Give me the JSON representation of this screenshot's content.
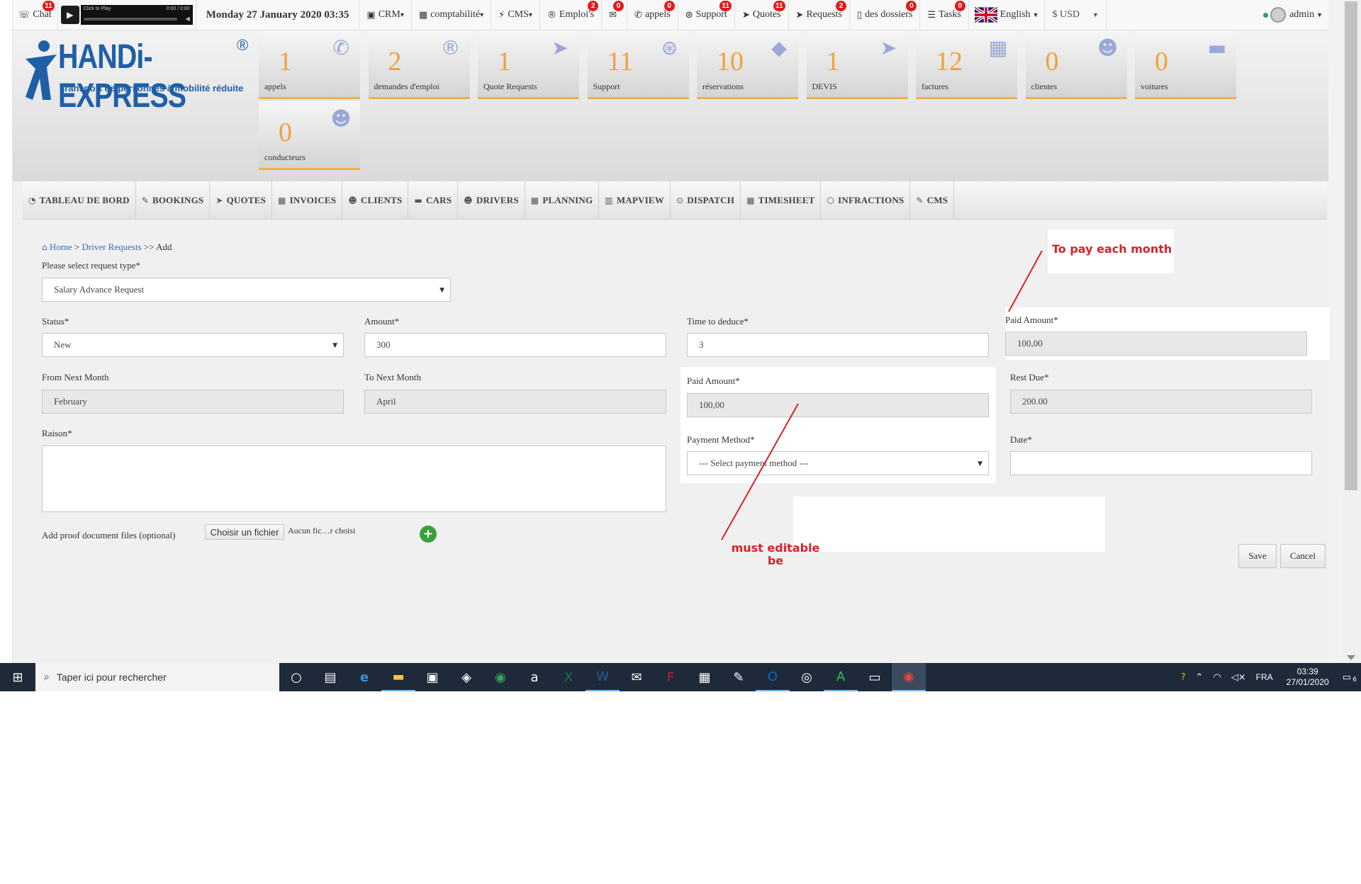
{
  "topnav": {
    "chat": {
      "label": "Chat",
      "badge": "11"
    },
    "player": {
      "title": "Click to Play",
      "time": "0:00 / 0:00"
    },
    "date": "Monday 27 January 2020 03:35",
    "items": [
      {
        "icon": "briefcase-icon",
        "glyph": "▣",
        "label": "CRM",
        "badge": ""
      },
      {
        "icon": "calculator-icon",
        "glyph": "▦",
        "label": "comptabilité",
        "badge": ""
      },
      {
        "icon": "bolt-icon",
        "glyph": "⚡",
        "label": "CMS",
        "badge": ""
      },
      {
        "icon": "registered-icon",
        "glyph": "®",
        "label": "Emploi's",
        "badge": "2"
      },
      {
        "icon": "envelope-icon",
        "glyph": "✉",
        "label": "",
        "badge": "0"
      },
      {
        "icon": "phone-icon",
        "glyph": "✆",
        "label": "appels",
        "badge": "0"
      },
      {
        "icon": "support-icon",
        "glyph": "⊛",
        "label": "Support",
        "badge": "11"
      },
      {
        "icon": "paper-plane-icon",
        "glyph": "➤",
        "label": "Quotes",
        "badge": "11"
      },
      {
        "icon": "paper-plane-icon",
        "glyph": "➤",
        "label": "Requests",
        "badge": "2"
      },
      {
        "icon": "file-icon",
        "glyph": "▯",
        "label": "des dossiers",
        "badge": "0"
      },
      {
        "icon": "tasks-icon",
        "glyph": "☰",
        "label": "Tasks",
        "badge": "0"
      }
    ],
    "language": "English",
    "currency": "$ USD",
    "user": "admin"
  },
  "logo": {
    "name": "HANDi-EXPRESS",
    "reg": "®",
    "tagline": "Transport de personnes à mobilité réduite"
  },
  "tiles": [
    {
      "value": "1",
      "label": "appels",
      "icon": "phone-icon",
      "glyph": "✆"
    },
    {
      "value": "2",
      "label": "demandes d'emploi",
      "icon": "registered-icon",
      "glyph": "®"
    },
    {
      "value": "1",
      "label": "Quote Requests",
      "icon": "paper-plane-icon",
      "glyph": "➤"
    },
    {
      "value": "11",
      "label": "Support",
      "icon": "support-icon",
      "glyph": "⊛"
    },
    {
      "value": "10",
      "label": "réservations",
      "icon": "ticket-icon",
      "glyph": "◆"
    },
    {
      "value": "1",
      "label": "DEVIS",
      "icon": "paper-plane-icon",
      "glyph": "➤"
    },
    {
      "value": "12",
      "label": "factures",
      "icon": "calculator-icon",
      "glyph": "▦"
    },
    {
      "value": "0",
      "label": "clientes",
      "icon": "users-icon",
      "glyph": "☻"
    },
    {
      "value": "0",
      "label": "voitures",
      "icon": "car-icon",
      "glyph": "▬"
    },
    {
      "value": "0",
      "label": "conducteurs",
      "icon": "user-icon",
      "glyph": "☻"
    }
  ],
  "menu": [
    {
      "label": "TABLEAU DE BORD",
      "glyph": "◔"
    },
    {
      "label": "BOOKINGS",
      "glyph": "✎"
    },
    {
      "label": "QUOTES",
      "glyph": "➤"
    },
    {
      "label": "INVOICES",
      "glyph": "▦"
    },
    {
      "label": "CLIENTS",
      "glyph": "☻"
    },
    {
      "label": "CARS",
      "glyph": "▬"
    },
    {
      "label": "DRIVERS",
      "glyph": "☻"
    },
    {
      "label": "PLANNING",
      "glyph": "▦"
    },
    {
      "label": "MAPVIEW",
      "glyph": "▥"
    },
    {
      "label": "DISPATCH",
      "glyph": "⊙"
    },
    {
      "label": "TIMESHEET",
      "glyph": "▦"
    },
    {
      "label": "INFRACTIONS",
      "glyph": "⬡"
    },
    {
      "label": "CMS",
      "glyph": "✎"
    }
  ],
  "breadcrumb": {
    "home": "Home",
    "sep1": ">",
    "section": "Driver Requests",
    "sep2": ">>",
    "current": "Add"
  },
  "form": {
    "request_type_label": "Please select request type*",
    "request_type_value": "Salary Advance Request",
    "status_label": "Status*",
    "status_value": "New",
    "amount_label": "Amount*",
    "amount_value": "300",
    "time_label": "Time to deduce*",
    "time_value": "3",
    "paid_label_top": "Paid Amount*",
    "paid_value_top": "100,00",
    "from_label": "From Next Month",
    "from_value": "February",
    "to_label": "To Next Month",
    "to_value": "April",
    "paid_label": "Paid Amount*",
    "paid_value": "100,00",
    "rest_label": "Rest Due*",
    "rest_value": "200.00",
    "raison_label": "Raison*",
    "payment_label": "Payment Method*",
    "payment_placeholder": "--- Select payment method ---",
    "date_label": "Date*",
    "proof_label": "Add proof document files (optional)",
    "file_button": "Choisir un fichier",
    "file_status": "Aucun fic…r choisi",
    "save": "Save",
    "cancel": "Cancel"
  },
  "annotations": {
    "top": "To pay each month",
    "bottom_line1": "must editable",
    "bottom_line2": "be",
    "color": "#d7232b"
  },
  "taskbar": {
    "search_placeholder": "Taper ici pour rechercher",
    "lang": "FRA",
    "time": "03:39",
    "date": "27/01/2020",
    "notif": "6"
  }
}
